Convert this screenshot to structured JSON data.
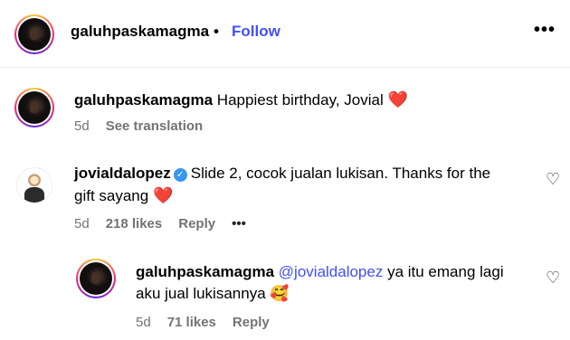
{
  "header": {
    "username": "galuhpaskamagma",
    "separator": "•",
    "follow_label": "Follow",
    "more_label": "•••"
  },
  "caption": {
    "username": "galuhpaskamagma",
    "text": "Happiest birthday, Jovial",
    "emoji": "❤️",
    "time": "5d",
    "see_translation": "See translation"
  },
  "comment": {
    "username": "jovialdalopez",
    "verified": true,
    "text_line1": "Slide 2, cocok jualan lukisan. Thanks for the",
    "text_line2": "gift sayang",
    "emoji": "❤️",
    "time": "5d",
    "likes": "218 likes",
    "reply_label": "Reply",
    "more_label": "•••",
    "like_icon": "♡"
  },
  "reply": {
    "username": "galuhpaskamagma",
    "mention": "@jovialdalopez",
    "text_line1": "ya itu emang lagi",
    "text_line2": "aku jual lukisannya",
    "emoji": "🥰",
    "time": "5d",
    "likes": "71 likes",
    "reply_label": "Reply",
    "like_icon": "♡"
  }
}
